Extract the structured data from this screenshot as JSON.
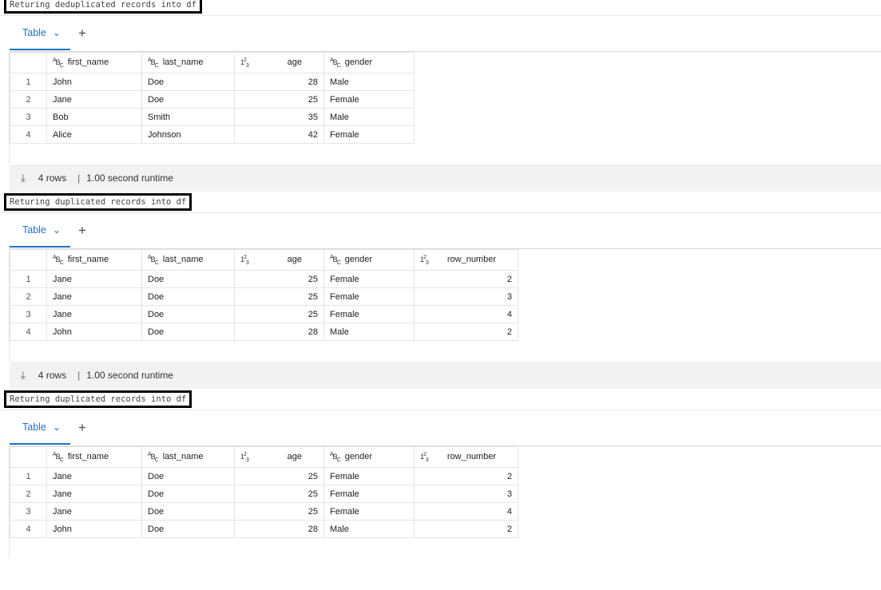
{
  "cells": [
    {
      "caption": "Returing deduplicated records into df",
      "tab_label": "Table",
      "add_label": "+",
      "columns": [
        {
          "type": "ABC",
          "name": "first_name"
        },
        {
          "type": "ABC",
          "name": "last_name"
        },
        {
          "type": "123",
          "name": "age"
        },
        {
          "type": "ABC",
          "name": "gender"
        }
      ],
      "rows": [
        [
          "1",
          "John",
          "Doe",
          "28",
          "Male"
        ],
        [
          "2",
          "Jane",
          "Doe",
          "25",
          "Female"
        ],
        [
          "3",
          "Bob",
          "Smith",
          "35",
          "Male"
        ],
        [
          "4",
          "Alice",
          "Johnson",
          "42",
          "Female"
        ]
      ],
      "footer": {
        "rows_label": "4 rows",
        "runtime_label": "1.00 second runtime"
      }
    },
    {
      "caption": "Returing duplicated records into df",
      "tab_label": "Table",
      "add_label": "+",
      "columns": [
        {
          "type": "ABC",
          "name": "first_name"
        },
        {
          "type": "ABC",
          "name": "last_name"
        },
        {
          "type": "123",
          "name": "age"
        },
        {
          "type": "ABC",
          "name": "gender"
        },
        {
          "type": "123",
          "name": "row_number"
        }
      ],
      "rows": [
        [
          "1",
          "Jane",
          "Doe",
          "25",
          "Female",
          "2"
        ],
        [
          "2",
          "Jane",
          "Doe",
          "25",
          "Female",
          "3"
        ],
        [
          "3",
          "Jane",
          "Doe",
          "25",
          "Female",
          "4"
        ],
        [
          "4",
          "John",
          "Doe",
          "28",
          "Male",
          "2"
        ]
      ],
      "footer": {
        "rows_label": "4 rows",
        "runtime_label": "1.00 second runtime"
      }
    },
    {
      "caption": "Returing duplicated records into df",
      "tab_label": "Table",
      "add_label": "+",
      "columns": [
        {
          "type": "ABC",
          "name": "first_name"
        },
        {
          "type": "ABC",
          "name": "last_name"
        },
        {
          "type": "123",
          "name": "age"
        },
        {
          "type": "ABC",
          "name": "gender"
        },
        {
          "type": "123",
          "name": "row_number"
        }
      ],
      "rows": [
        [
          "1",
          "Jane",
          "Doe",
          "25",
          "Female",
          "2"
        ],
        [
          "2",
          "Jane",
          "Doe",
          "25",
          "Female",
          "3"
        ],
        [
          "3",
          "Jane",
          "Doe",
          "25",
          "Female",
          "4"
        ],
        [
          "4",
          "John",
          "Doe",
          "28",
          "Male",
          "2"
        ]
      ],
      "footer": null
    }
  ],
  "colors": {
    "accent": "#1b73c7",
    "footer_bg": "#f0f2f3"
  }
}
